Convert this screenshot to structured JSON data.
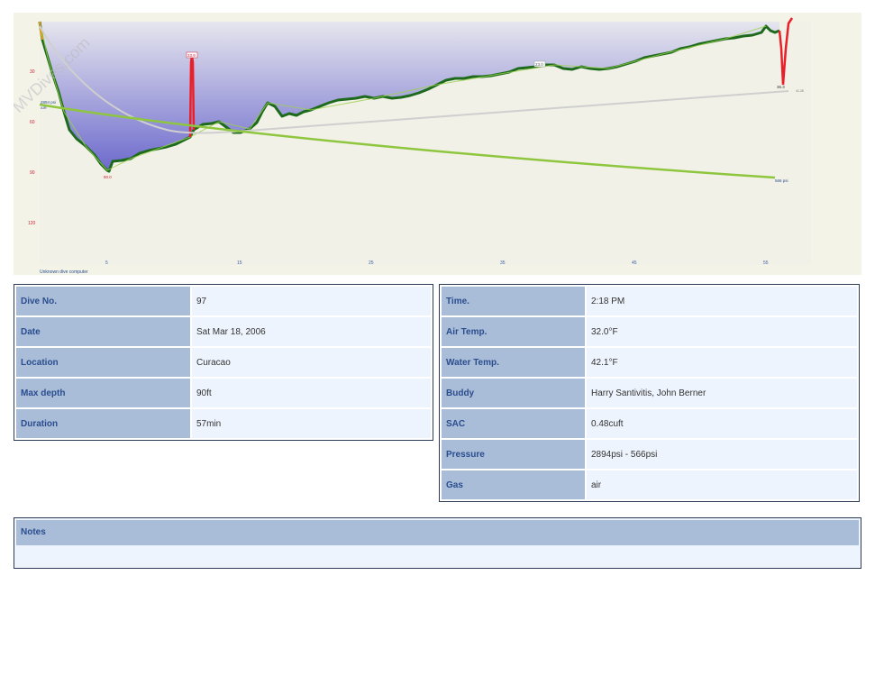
{
  "watermark": "MVDives.com",
  "profile": {
    "depth_ticks": [
      "30",
      "60",
      "90",
      "120"
    ],
    "time_ticks": [
      "5",
      "15",
      "25",
      "35",
      "45",
      "55"
    ],
    "max_depth_label": "90.0",
    "spike_label": "33.9",
    "mid_label": "23.0",
    "end_label": "36.3",
    "start_pressure_label": "2894 psi",
    "gas_label": "AIR",
    "end_pressure_label": "566 psi",
    "ceiling_label": "41.28",
    "computer_label": "Unknown dive computer",
    "colors": {
      "depth_line": "#1d6a1d",
      "ascent_fast": "#e8202a",
      "pressure": "#8ec63f",
      "temperature": "#cfcfcf",
      "fill_top": "#e6e6ee",
      "fill_bottom": "#6c69cc",
      "background": "#f4f3e8"
    }
  },
  "left": {
    "dive_no_label": "Dive No.",
    "dive_no": "97",
    "date_label": "Date",
    "date": "Sat Mar 18, 2006",
    "location_label": "Location",
    "location": "Curacao",
    "max_depth_label": "Max depth",
    "max_depth": "90ft",
    "duration_label": "Duration",
    "duration": "57min"
  },
  "right": {
    "time_label": "Time.",
    "time": "2:18 PM",
    "air_temp_label": "Air Temp.",
    "air_temp": "32.0°F",
    "water_temp_label": "Water Temp.",
    "water_temp": "42.1°F",
    "buddy_label": "Buddy",
    "buddy": "Harry Santivitis, John Berner",
    "sac_label": "SAC",
    "sac": "0.48cuft",
    "pressure_label": "Pressure",
    "pressure": "2894psi - 566psi",
    "gas_label": "Gas",
    "gas": "air"
  },
  "notes": {
    "label": "Notes",
    "text": ""
  }
}
